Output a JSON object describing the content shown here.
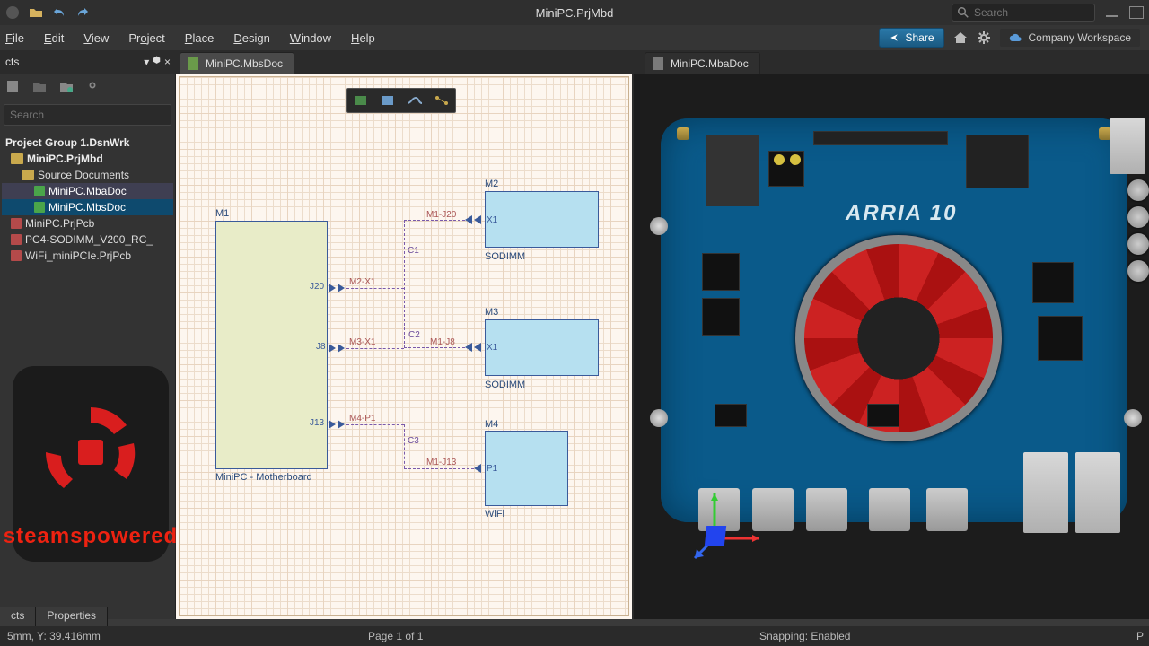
{
  "title": "MiniPC.PrjMbd",
  "search_placeholder": "Search",
  "menu": [
    "File",
    "Edit",
    "View",
    "Project",
    "Place",
    "Design",
    "Window",
    "Help"
  ],
  "share": "Share",
  "workspace": "Company Workspace",
  "projects_label": "cts",
  "tabs": [
    {
      "label": "MiniPC.MbsDoc",
      "active": true
    },
    {
      "label": "MiniPC.MbaDoc",
      "active": false
    }
  ],
  "side_search_placeholder": "Search",
  "tree": {
    "group": "Project Group 1.DsnWrk",
    "project": "MiniPC.PrjMbd",
    "folder": "Source Documents",
    "docs": [
      "MiniPC.MbaDoc",
      "MiniPC.MbsDoc"
    ],
    "others": [
      "MiniPC.PrjPcb",
      "PC4-SODIMM_V200_RC_",
      "WiFi_miniPCIe.PrjPcb"
    ]
  },
  "logo_text": "steamspowered",
  "schematic": {
    "m1": {
      "id": "M1",
      "name": "MiniPC - Motherboard"
    },
    "m2": {
      "id": "M2",
      "name": "SODIMM",
      "port": "X1"
    },
    "m3": {
      "id": "M3",
      "name": "SODIMM",
      "port": "X1"
    },
    "m4": {
      "id": "M4",
      "name": "WiFi",
      "port": "P1"
    },
    "m1_ports": {
      "j20": "J20",
      "j8": "J8",
      "j13": "J13"
    },
    "wires": {
      "c1": "C1",
      "c2": "C2",
      "c3": "C3",
      "m2x1": "M2-X1",
      "m3x1": "M3-X1",
      "m4p1": "M4-P1",
      "m1j20": "M1-J20",
      "m1j8": "M1-J8",
      "m1j13": "M1-J13"
    }
  },
  "pcb_label": "ARRIA 10",
  "bottom_tabs": [
    "cts",
    "Properties"
  ],
  "status": {
    "coords": "5mm, Y: 39.416mm",
    "page": "Page 1 of 1",
    "snap": "Snapping: Enabled",
    "panel": "P"
  }
}
